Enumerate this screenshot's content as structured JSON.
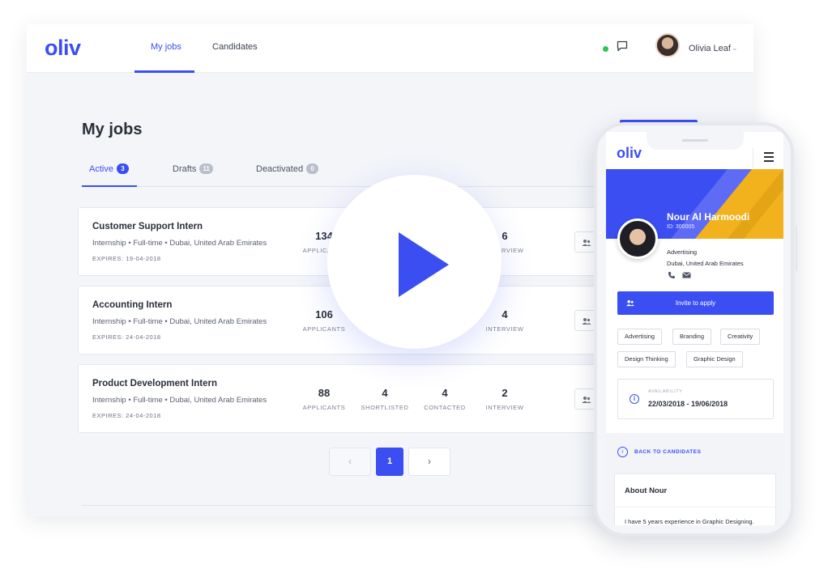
{
  "desktop": {
    "logo": "oliv",
    "nav": [
      {
        "label": "My jobs"
      },
      {
        "label": "Candidates"
      }
    ],
    "user": {
      "name": "Olivia Leaf"
    },
    "status_color": "#2ec450",
    "page_title": "My jobs",
    "tabs": [
      {
        "label": "Active",
        "count": "3"
      },
      {
        "label": "Drafts",
        "count": "11"
      },
      {
        "label": "Deactivated",
        "count": "0"
      }
    ],
    "jobs": [
      {
        "title": "Customer Support Intern",
        "meta": "Internship • Full-time • Dubai, United Arab Emirates",
        "expires": "EXPIRES: 19-04-2018",
        "stats": [
          {
            "value": "134",
            "label": "APPLICANTS"
          },
          {
            "value": "6",
            "label": "INTERVIEW"
          }
        ]
      },
      {
        "title": "Accounting Intern",
        "meta": "Internship • Full-time • Dubai, United Arab Emirates",
        "expires": "EXPIRES: 24-04-2018",
        "stats": [
          {
            "value": "106",
            "label": "APPLICANTS"
          },
          {
            "value": "4",
            "label": "INTERVIEW"
          }
        ]
      },
      {
        "title": "Product Development Intern",
        "meta": "Internship • Full-time • Dubai, United Arab Emirates",
        "expires": "EXPIRES: 24-04-2018",
        "stats": [
          {
            "value": "88",
            "label": "APPLICANTS"
          },
          {
            "value": "4",
            "label": "SHORTLISTED"
          },
          {
            "value": "4",
            "label": "CONTACTED"
          },
          {
            "value": "2",
            "label": "INTERVIEW"
          }
        ]
      }
    ],
    "pager": {
      "prev": "‹",
      "current": "1",
      "next": "›"
    },
    "accent_color": "#3a4ef2"
  },
  "phone": {
    "logo": "oliv",
    "candidate": {
      "name": "Nour Al Harmoodi",
      "id": "ID: 300005",
      "field": "Advertising",
      "location": "Dubai, United Arab Emirates"
    },
    "invite_label": "Invite to apply",
    "skills": [
      "Advertising",
      "Branding",
      "Creativity",
      "Design Thinking",
      "Graphic Design"
    ],
    "availability": {
      "label": "AVAILABILITY",
      "value": "22/03/2018 - 19/06/2018"
    },
    "back_label": "BACK TO CANDIDATES",
    "about": {
      "title": "About Nour",
      "text": "I have 5 years experience in Graphic Designing."
    },
    "banner_colors": [
      "#3a4ef2",
      "#f2b21e"
    ]
  }
}
